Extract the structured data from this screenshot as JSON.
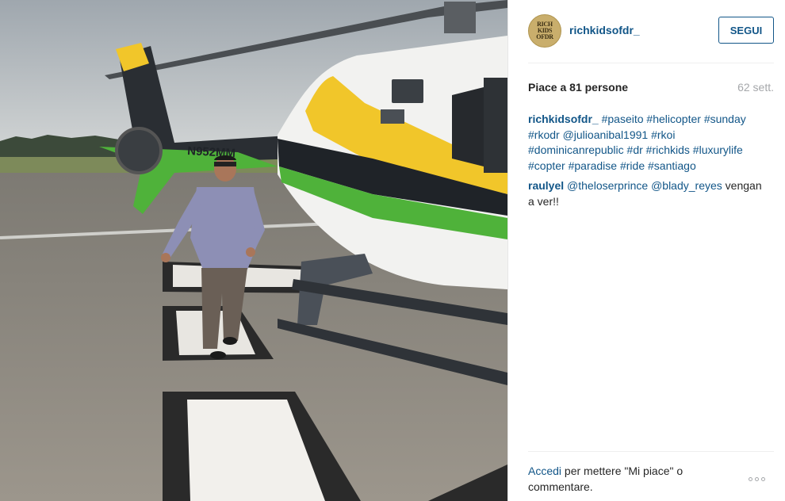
{
  "post": {
    "username": "richkidsofdr_",
    "avatar_text": [
      "RICH",
      "KIDS",
      "OF",
      "DR"
    ],
    "follow_label": "SEGUI",
    "likes": "Piace a 81 persone",
    "age": "62 sett.",
    "caption": {
      "author": "richkidsofdr_",
      "hashtags": [
        "#paseito",
        "#helicopter",
        "#sunday",
        "#rkodr",
        "@julioanibal1991",
        "#rkoi",
        "#dominicanrepublic",
        "#dr",
        "#richkids",
        "#luxurylife",
        "#copter",
        "#paradise",
        "#ride",
        "#santiago"
      ]
    },
    "comment": {
      "author": "raulyel",
      "mentions": [
        "@theloserprince",
        "@blady_reyes"
      ],
      "text": "vengan a ver!!"
    },
    "login_prompt": {
      "link": "Accedi",
      "text": "per mettere \"Mi piace\" o commentare."
    }
  },
  "photo": {
    "tail_number": "N952MM",
    "colors": {
      "sky": "#b9c0c6",
      "tarmac": "#8e8a84",
      "helicopter_body": "#f2f2f0",
      "yellow_stripe": "#f1c62a",
      "green_stripe": "#4fb23a",
      "dark_stripe": "#1f2328"
    }
  },
  "colors": {
    "link": "#125688",
    "text": "#262626",
    "muted": "#a5a7aa",
    "divider": "#efefef"
  }
}
